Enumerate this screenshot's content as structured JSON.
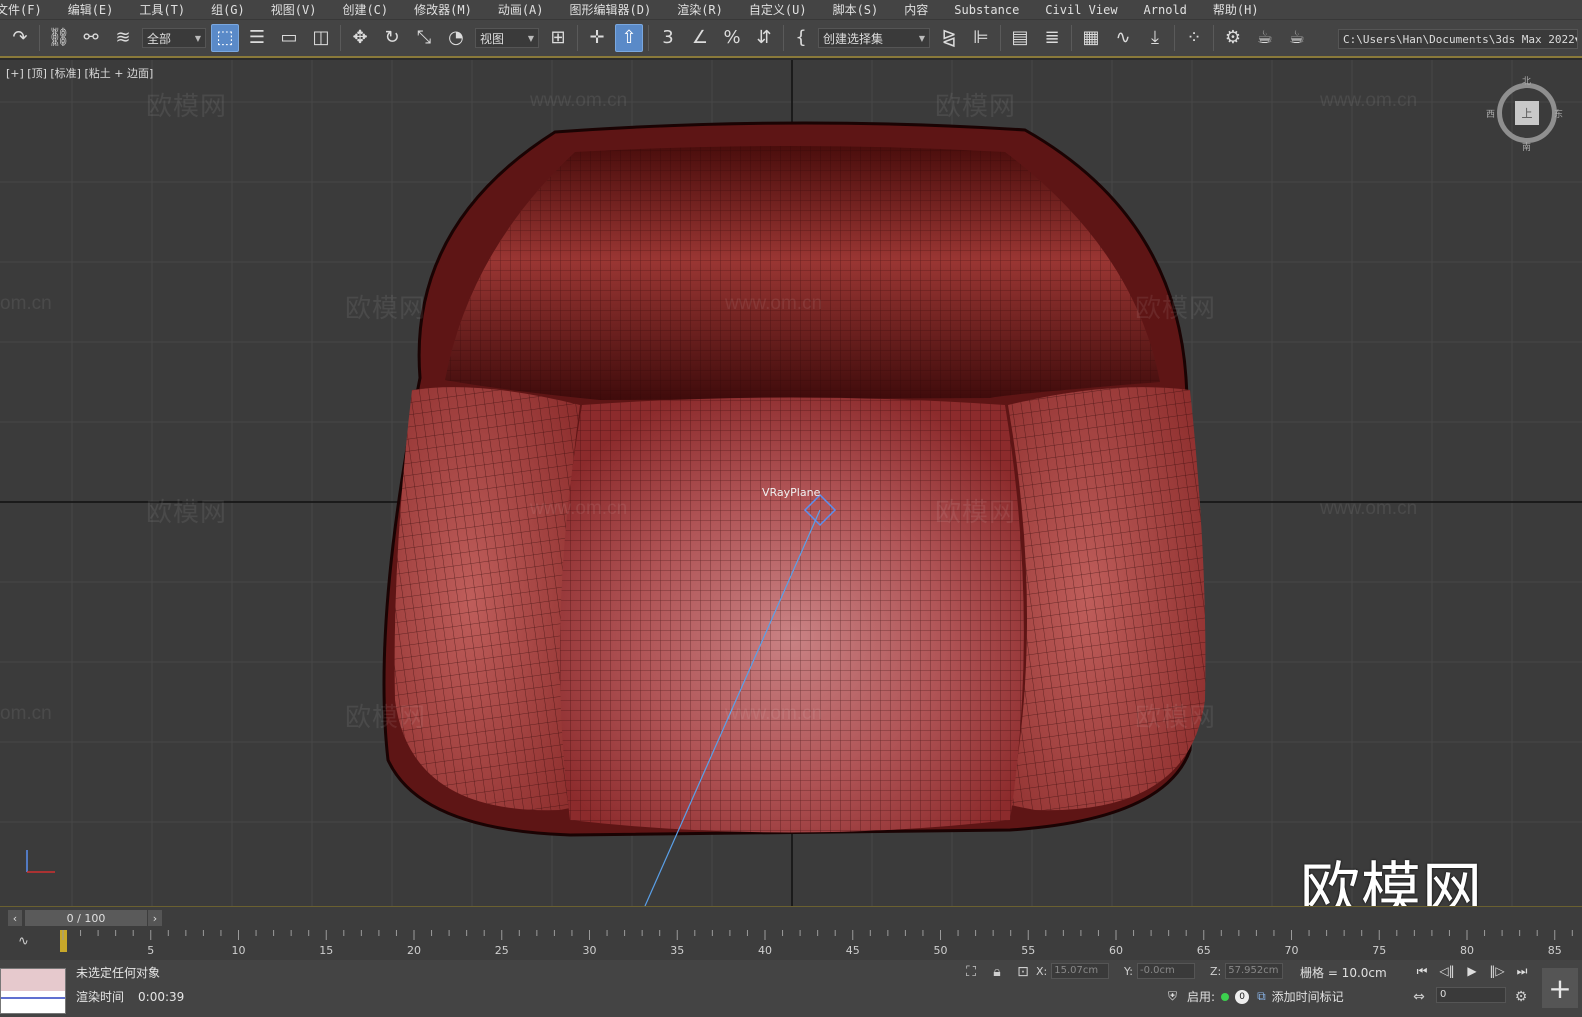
{
  "menu": [
    "文件(F)",
    "编辑(E)",
    "工具(T)",
    "组(G)",
    "视图(V)",
    "创建(C)",
    "修改器(M)",
    "动画(A)",
    "图形编辑器(D)",
    "渲染(R)",
    "自定义(U)",
    "脚本(S)",
    "内容",
    "Substance",
    "Civil View",
    "Arnold",
    "帮助(H)"
  ],
  "toolbar": {
    "selection_filter": "全部",
    "reference_coord": "视图",
    "named_selection": "创建选择集",
    "project_path": "C:\\Users\\Han\\Documents\\3ds Max 2022",
    "icons": [
      "undo-icon",
      "redo-icon",
      "link-icon",
      "unlink-icon",
      "bind-space-warp-icon",
      "select-object-icon",
      "select-by-name-icon",
      "rect-region-icon",
      "window-crossing-icon",
      "move-icon",
      "rotate-icon",
      "scale-icon",
      "placement-icon",
      "pivot-icon",
      "snap-toggle-icon",
      "angle-snap-icon",
      "percent-snap-icon",
      "spinner-snap-icon",
      "edit-named-sets-icon",
      "mirror-icon",
      "align-icon",
      "scene-explorer-icon",
      "layer-explorer-icon",
      "ribbon-icon",
      "curve-editor-icon",
      "schematic-view-icon",
      "material-editor-icon",
      "render-setup-icon",
      "rendered-frame-icon",
      "render-production-icon"
    ]
  },
  "viewport": {
    "label": "[+] [顶] [标准] [粘土 + 边面]",
    "object_label": "VRayPlane",
    "viewcube": {
      "face": "上",
      "north": "北",
      "south": "南",
      "east": "东",
      "west": "西"
    },
    "watermark_url": "www.om.cn",
    "watermark_cn": "欧模网",
    "watermark_partial": "om.cn",
    "logo": "欧模网",
    "mesh_color": "#a6383a"
  },
  "timeline": {
    "frame_display": "0 / 100",
    "ticks": [
      "5",
      "10",
      "15",
      "20",
      "25",
      "30",
      "35",
      "40",
      "45",
      "50",
      "55",
      "60",
      "65",
      "70",
      "75",
      "80",
      "85"
    ]
  },
  "status": {
    "message": "未选定任何对象",
    "render_time_label": "渲染时间",
    "render_time_value": "0:00:39",
    "x_label": "X:",
    "x_value": "15.07cm",
    "y_label": "Y:",
    "y_value": "-0.0cm",
    "z_label": "Z:",
    "z_value": "57.952cm",
    "grid": "栅格 = 10.0cm",
    "enable_label": "启用:",
    "enable_count": "0",
    "add_time_tag": "添加时间标记",
    "frame_value": "0"
  }
}
